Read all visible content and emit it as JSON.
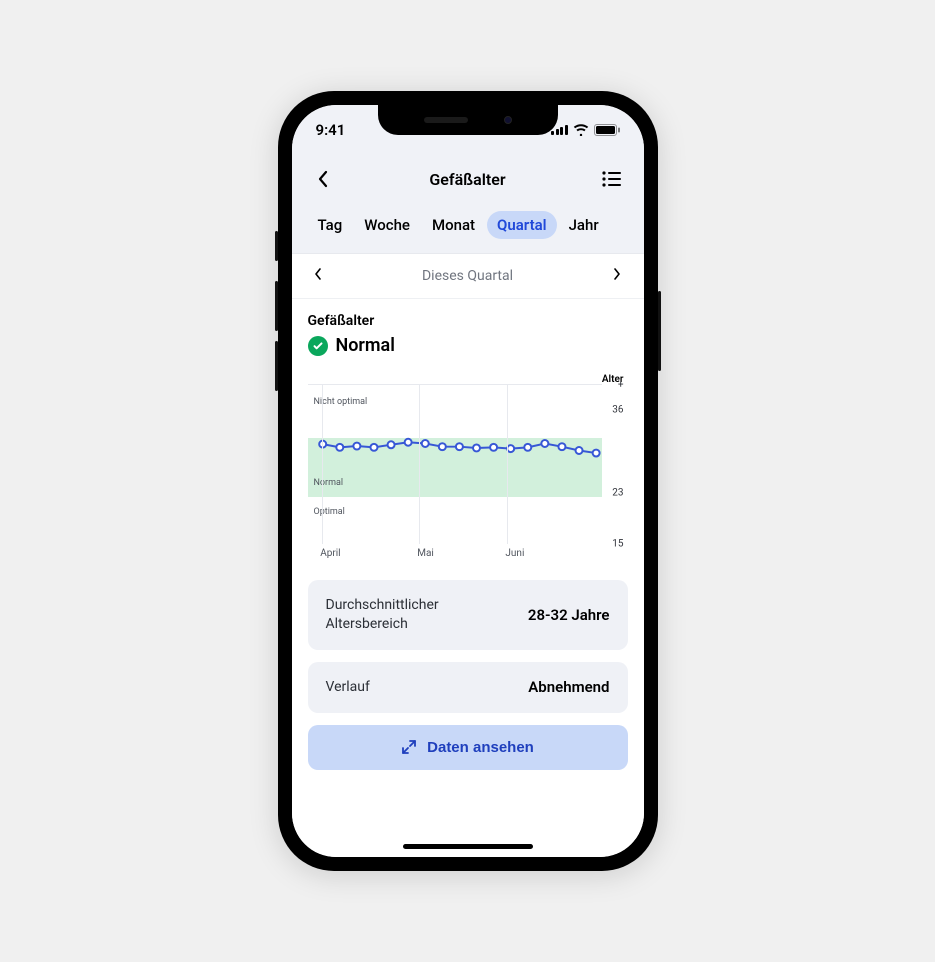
{
  "status_bar": {
    "time": "9:41"
  },
  "header": {
    "title": "Gefäßalter",
    "tabs": [
      "Tag",
      "Woche",
      "Monat",
      "Quartal",
      "Jahr"
    ],
    "active_tab_index": 3
  },
  "period": {
    "label": "Dieses Quartal"
  },
  "section": {
    "title": "Gefäßalter",
    "status": "Normal",
    "status_color": "#0aa75c"
  },
  "chart_data": {
    "type": "line",
    "title": "",
    "ylabel": "Alter",
    "ylim": [
      15,
      40
    ],
    "y_ticks": [
      {
        "label": "+",
        "value": 40
      },
      {
        "label": "36",
        "value": 36
      },
      {
        "label": "23",
        "value": 23
      },
      {
        "label": "15",
        "value": 15
      }
    ],
    "bands": [
      {
        "name": "Nicht optimal",
        "from": 31.6,
        "to": 40
      },
      {
        "name": "Normal",
        "from": 22.4,
        "to": 31.6,
        "color": "#d2f0dc"
      },
      {
        "name": "Optimal",
        "from": 15,
        "to": 22.4
      }
    ],
    "x_label_pos": [
      {
        "label": "April",
        "pos": 0.05
      },
      {
        "label": "Mai",
        "pos": 0.38
      },
      {
        "label": "Juni",
        "pos": 0.68
      }
    ],
    "series": [
      {
        "name": "Gefäßalter",
        "color": "#3757d6",
        "values": [
          30.7,
          30.2,
          30.4,
          30.2,
          30.6,
          31.0,
          30.8,
          30.3,
          30.3,
          30.1,
          30.2,
          30.0,
          30.2,
          30.8,
          30.3,
          29.7,
          29.3
        ]
      }
    ]
  },
  "cards": {
    "avg_label": "Durchschnittlicher Altersbereich",
    "avg_value": "28-32 Jahre",
    "trend_label": "Verlauf",
    "trend_value": "Abnehmend"
  },
  "cta": {
    "label": "Daten ansehen"
  }
}
